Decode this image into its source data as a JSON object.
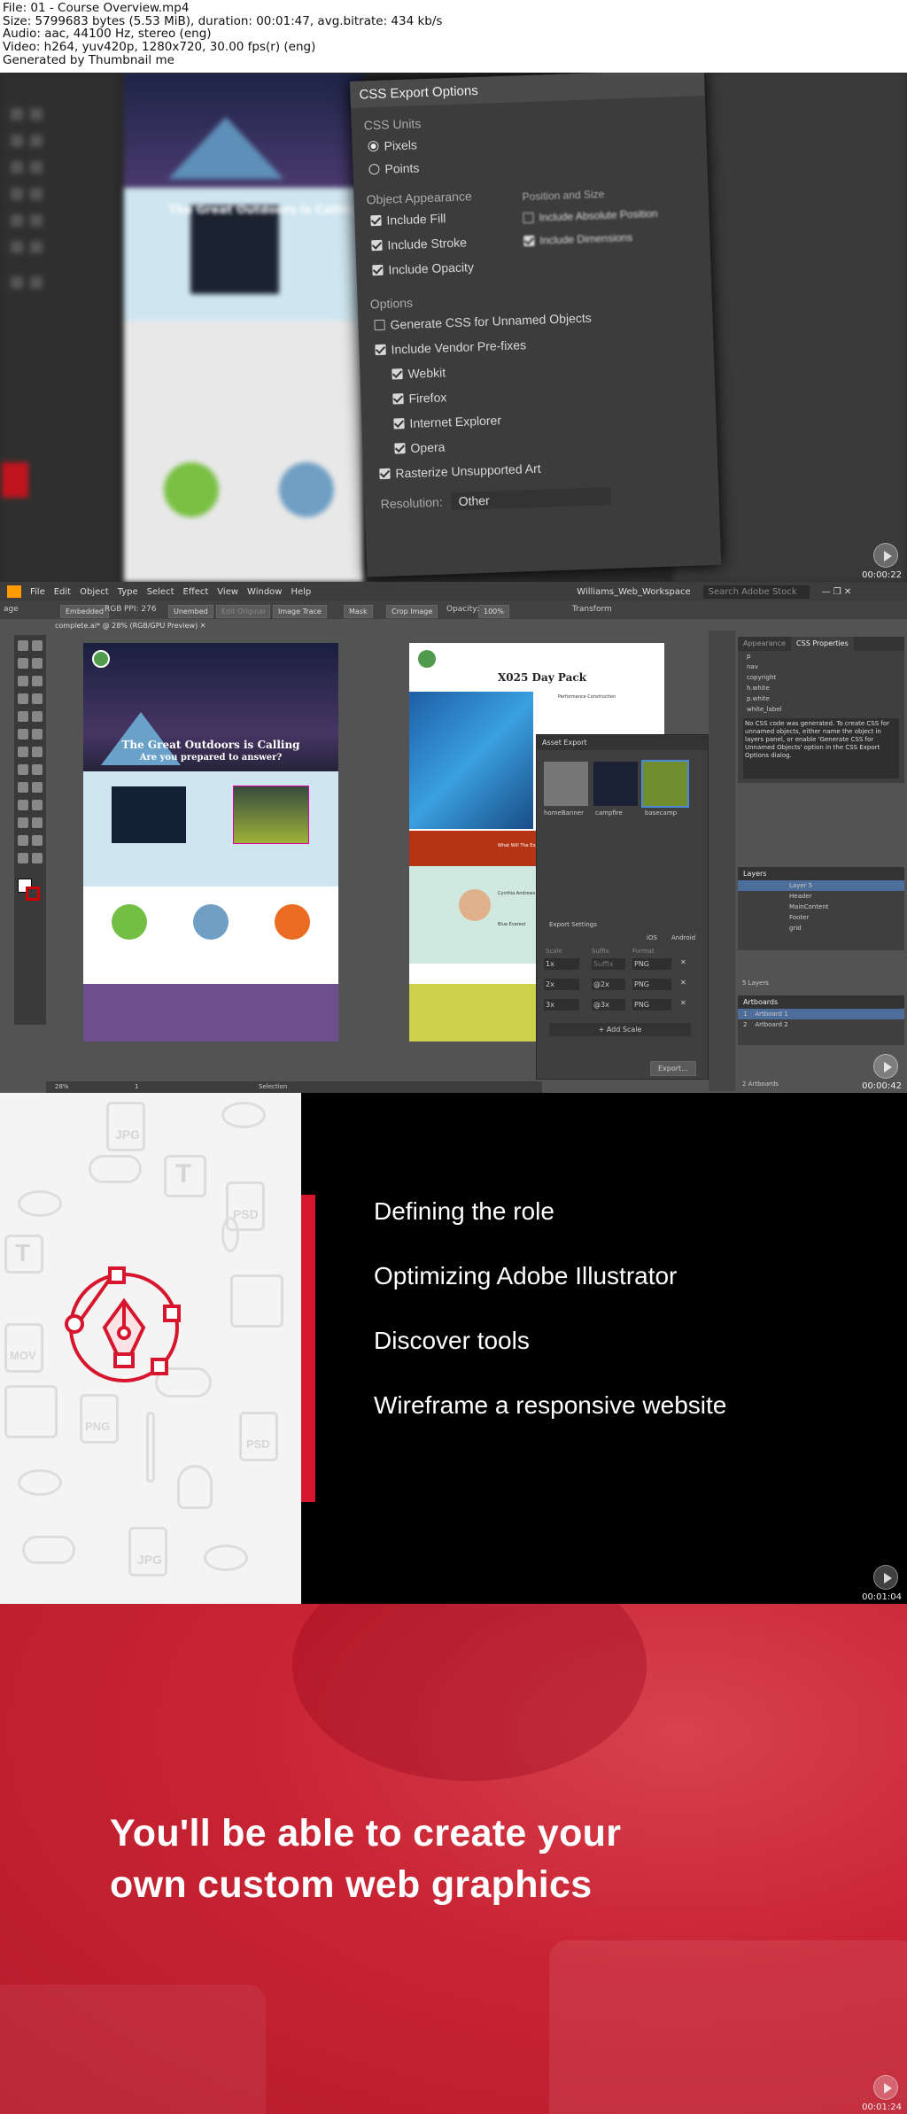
{
  "info": {
    "file": "File: 01 - Course Overview.mp4",
    "size": "Size: 5799683 bytes (5.53 MiB), duration: 00:01:47, avg.bitrate: 434 kb/s",
    "audio": "Audio: aac, 44100 Hz, stereo (eng)",
    "video": "Video: h264, yuv420p, 1280x720, 30.00 fps(r) (eng)",
    "generator": "Generated by Thumbnail me"
  },
  "frame1": {
    "timestamp": "00:00:22",
    "dialog": {
      "title": "CSS Export Options",
      "units_heading": "CSS Units",
      "units": [
        "Pixels",
        "Points"
      ],
      "appearance_heading": "Object Appearance",
      "appearance": [
        "Include Fill",
        "Include Stroke",
        "Include Opacity"
      ],
      "position_heading": "Position and Size",
      "position": [
        "Include Absolute Position",
        "Include Dimensions"
      ],
      "options_heading": "Options",
      "options": [
        "Generate CSS for Unnamed Objects",
        "Include Vendor Pre-fixes",
        "Webkit",
        "Firefox",
        "Internet Explorer",
        "Opera",
        "Rasterize Unsupported Art"
      ],
      "resolution_label": "Resolution:",
      "resolution_value": "Other"
    },
    "bg_headline": "The Great Outdoors is Calling"
  },
  "frame2": {
    "timestamp": "00:00:42",
    "menu": [
      "File",
      "Edit",
      "Object",
      "Type",
      "Select",
      "Effect",
      "View",
      "Window",
      "Help"
    ],
    "workspace": "Williams_Web_Workspace",
    "search_placeholder": "Search Adobe Stock",
    "control": {
      "left": "age",
      "embedded": "Embedded",
      "rgb": "RGB",
      "ppi": "PPI: 276",
      "unembed": "Unembed",
      "edit_original": "Edit Original",
      "image_trace": "Image Trace",
      "mask": "Mask",
      "crop": "Crop Image",
      "opacity_label": "Opacity:",
      "opacity": "100%",
      "transform": "Transform"
    },
    "doc_tab": "complete.ai* @ 28% (RGB/GPU Preview)",
    "artboard1": {
      "headline": "The Great Outdoors is Calling",
      "subhead": "Are you prepared to answer?"
    },
    "artboard2": {
      "headline": "X025 Day Pack",
      "subtitle": "Performance Construction",
      "section": "What Will The Explorer",
      "author": "Cynthia Andrews",
      "blog": "Blue Everest"
    },
    "asset_export": {
      "title": "Asset Export",
      "thumbs": [
        "homeBanner",
        "campfire",
        "basecamp"
      ],
      "settings": "Export Settings",
      "ios": "iOS",
      "android": "Android",
      "scale_header": "Scale",
      "suffix_header": "Suffix",
      "format_header": "Format",
      "rows": [
        {
          "scale": "1x",
          "suffix": "Suffix",
          "fmt": "PNG"
        },
        {
          "scale": "2x",
          "suffix": "@2x",
          "fmt": "PNG"
        },
        {
          "scale": "3x",
          "suffix": "@3x",
          "fmt": "PNG"
        }
      ],
      "add_scale": "+ Add Scale",
      "export": "Export..."
    },
    "css_panel": {
      "tabs": [
        "Appearance",
        "CSS Properties"
      ],
      "items": [
        "p",
        "nav",
        "copyright",
        "h.white",
        "p.white",
        "white_label"
      ],
      "message": "No CSS code was generated. To create CSS for unnamed objects, either name the object in layers panel, or enable 'Generate CSS for Unnamed Objects' option in the CSS Export Options dialog."
    },
    "layers": {
      "title": "Layers",
      "items": [
        "Layer 5",
        "Header",
        "MainContent",
        "Footer",
        "grid"
      ],
      "count": "5 Layers"
    },
    "artboards": {
      "title": "Artboards",
      "items": [
        {
          "n": "1",
          "name": "Artboard 1"
        },
        {
          "n": "2",
          "name": "Artboard 2"
        }
      ],
      "count": "2 Artboards"
    },
    "status": {
      "zoom": "28%",
      "page": "1",
      "mode": "Selection"
    }
  },
  "frame3": {
    "timestamp": "00:01:04",
    "bullets": [
      "Defining the role",
      "Optimizing Adobe Illustrator",
      "Discover tools",
      "Wireframe a responsive website"
    ],
    "icon_labels": [
      "JPG",
      "PSD",
      "MOV",
      "PNG",
      "PSD",
      "JPG"
    ]
  },
  "frame4": {
    "timestamp": "00:01:24",
    "headline_line1": "You'll be able to create your",
    "headline_line2": "own custom web graphics"
  },
  "colors": {
    "accent_red": "#d7152c",
    "banner_red": "#c82333",
    "ui_dark": "#3c3c3c",
    "artboard_blue": "#cfe6f0",
    "artboard_purple": "#6c4f8c"
  }
}
